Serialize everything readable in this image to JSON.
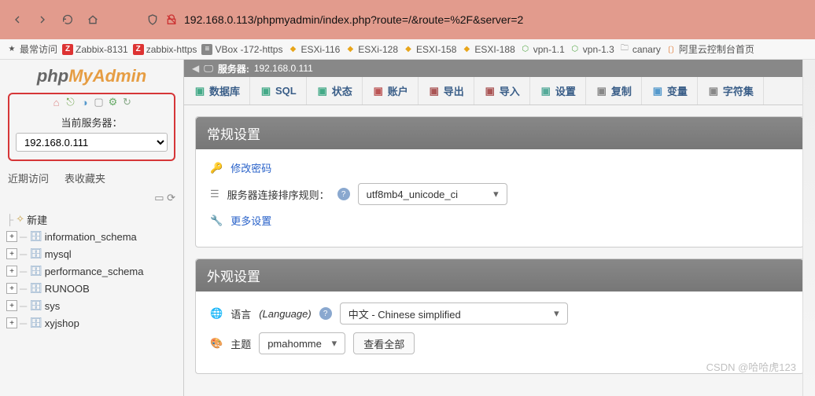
{
  "browser": {
    "url": "192.168.0.113/phpmyadmin/index.php?route=/&route=%2F&server=2",
    "url_host": "192.168.0.113"
  },
  "bookmarks": [
    {
      "label": "最常访问",
      "icon": "star"
    },
    {
      "label": "Zabbix-8131",
      "icon": "red"
    },
    {
      "label": "zabbix-https",
      "icon": "red"
    },
    {
      "label": "VBox -172-https",
      "icon": "gray"
    },
    {
      "label": "ESXi-116",
      "icon": "yel"
    },
    {
      "label": "ESXi-128",
      "icon": "yel"
    },
    {
      "label": "ESXI-158",
      "icon": "yel"
    },
    {
      "label": "ESXI-188",
      "icon": "yel"
    },
    {
      "label": "vpn-1.1",
      "icon": "green"
    },
    {
      "label": "vpn-1.3",
      "icon": "green"
    },
    {
      "label": "canary",
      "icon": "fold"
    },
    {
      "label": "阿里云控制台首页",
      "icon": "orange"
    }
  ],
  "logo": {
    "p1": "php",
    "p2": "MyAdmin"
  },
  "sidebar": {
    "server_label": "当前服务器：",
    "server_value": "192.168.0.111",
    "tabs": [
      "近期访问",
      "表收藏夹"
    ],
    "new": "新建",
    "dbs": [
      "information_schema",
      "mysql",
      "performance_schema",
      "RUNOOB",
      "sys",
      "xyjshop"
    ]
  },
  "server_bar": {
    "prefix": "服务器:",
    "name": "192.168.0.111"
  },
  "tabs": [
    {
      "label": "数据库",
      "icon": "#4a8"
    },
    {
      "label": "SQL",
      "icon": "#4a8"
    },
    {
      "label": "状态",
      "icon": "#4a8"
    },
    {
      "label": "账户",
      "icon": "#b55"
    },
    {
      "label": "导出",
      "icon": "#a55"
    },
    {
      "label": "导入",
      "icon": "#a55"
    },
    {
      "label": "设置",
      "icon": "#5a9"
    },
    {
      "label": "复制",
      "icon": "#888"
    },
    {
      "label": "变量",
      "icon": "#59c"
    },
    {
      "label": "字符集",
      "icon": "#888"
    }
  ],
  "panels": {
    "general": {
      "title": "常规设置",
      "change_pw": "修改密码",
      "collation_label": "服务器连接排序规则：",
      "collation_value": "utf8mb4_unicode_ci",
      "more": "更多设置"
    },
    "appearance": {
      "title": "外观设置",
      "lang_label": "语言",
      "lang_paren": "(Language)",
      "lang_value": "中文 - Chinese simplified",
      "theme_label": "主题",
      "theme_value": "pmahomme",
      "view_all": "查看全部"
    }
  },
  "watermark": "CSDN @哈哈虎123"
}
